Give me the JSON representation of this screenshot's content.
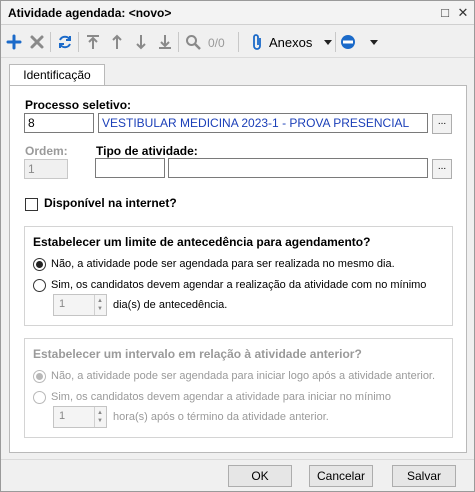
{
  "window": {
    "title": "Atividade agendada: <novo>"
  },
  "toolbar": {
    "page_counter": "0/0",
    "anexos_label": "Anexos",
    "icons": [
      "plus-icon",
      "delete-icon",
      "refresh-icon",
      "move-first-icon",
      "move-up-icon",
      "move-down-icon",
      "move-last-icon",
      "search-icon",
      "paperclip-icon",
      "circle-menu-icon"
    ]
  },
  "tabs": [
    {
      "label": "Identificação"
    }
  ],
  "form": {
    "processo_label": "Processo seletivo:",
    "processo_code": "8",
    "processo_name": "VESTIBULAR MEDICINA 2023-1 - PROVA PRESENCIAL",
    "ordem_label": "Ordem:",
    "ordem_value": "1",
    "tipo_label": "Tipo de atividade:",
    "tipo_code": "",
    "tipo_name": "",
    "dots": "...",
    "disponivel_label": "Disponível na internet?"
  },
  "group1": {
    "title": "Estabelecer um limite de antecedência para agendamento?",
    "option1": "Não, a atividade pode ser agendada para ser realizada no mesmo dia.",
    "option2": "Sim, os candidatos devem agendar a realização da atividade com no mínimo",
    "spin_value": "1",
    "spin_suffix": "dia(s) de antecedência."
  },
  "group2": {
    "title": "Estabelecer um intervalo em relação à atividade anterior?",
    "option1": "Não, a atividade pode ser agendada para iniciar logo após a atividade anterior.",
    "option2": "Sim, os candidatos devem agendar a atividade para iniciar no mínimo",
    "spin_value": "1",
    "spin_suffix": "hora(s) após o término da atividade anterior."
  },
  "buttons": {
    "ok": "OK",
    "cancel": "Cancelar",
    "save": "Salvar"
  },
  "colors": {
    "accent_blue": "#1b6ac9",
    "link_text_blue": "#1b3fb8"
  }
}
